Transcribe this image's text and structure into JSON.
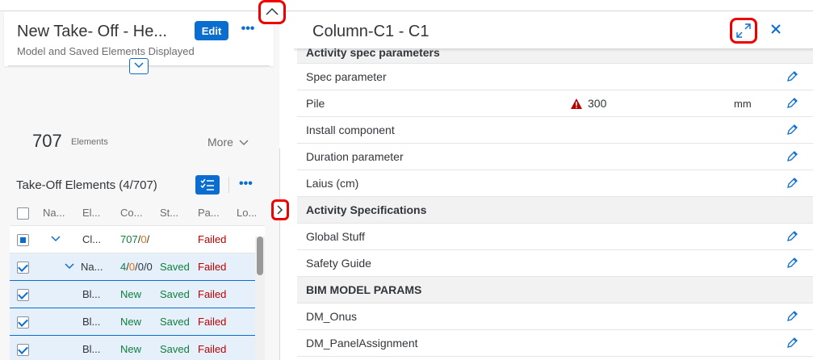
{
  "header": {
    "title": "New Take- Off - He...",
    "subtitle": "Model and Saved Elements Displayed",
    "edit_label": "Edit",
    "more_label": "•••"
  },
  "summary": {
    "count": "707",
    "count_label": "Elements",
    "more_label": "More"
  },
  "table": {
    "title": "Take-Off Elements (4/707)",
    "more_label": "•••",
    "columns": [
      "Na...",
      "El...",
      "Co...",
      "St...",
      "Pa...",
      "Lo..."
    ],
    "rows": [
      {
        "name": "",
        "element": "Cl...",
        "count_a": "707",
        "sep1": "/",
        "count_b": "0",
        "sep2": "/",
        "count_c": "",
        "status": "",
        "pa": "Failed"
      },
      {
        "name": "Na...",
        "element": "",
        "count_a": "4",
        "sep1": "/",
        "count_b": "0",
        "sep2": "/",
        "count_c": "0/0",
        "status": "Saved",
        "pa": "Failed"
      },
      {
        "name": "",
        "element": "Bl...",
        "count_a": "New",
        "status": "Saved",
        "pa": "Failed"
      },
      {
        "name": "",
        "element": "Bl...",
        "count_a": "New",
        "status": "Saved",
        "pa": "Failed"
      },
      {
        "name": "",
        "element": "Bl...",
        "count_a": "New",
        "status": "Saved",
        "pa": "Failed"
      }
    ]
  },
  "detail": {
    "title": "Column-C1 - C1",
    "sections": [
      {
        "label": "Activity spec parameters"
      },
      {
        "label": "Spec parameter"
      },
      {
        "label": "Pile",
        "value": "300",
        "unit": "mm"
      },
      {
        "label": "Install component"
      },
      {
        "label": "Duration parameter"
      },
      {
        "label": "Laius (cm)"
      },
      {
        "label": "Activity Specifications"
      },
      {
        "label": "Global Stuff"
      },
      {
        "label": "Safety Guide"
      },
      {
        "label": "BIM MODEL PARAMS"
      },
      {
        "label": "DM_Onus"
      },
      {
        "label": "DM_PanelAssignment"
      }
    ]
  },
  "colors": {
    "accent": "#0a6ed1",
    "success": "#107e3e",
    "warning": "#e9730c",
    "error": "#bb0000",
    "highlight": "#ee0000"
  }
}
